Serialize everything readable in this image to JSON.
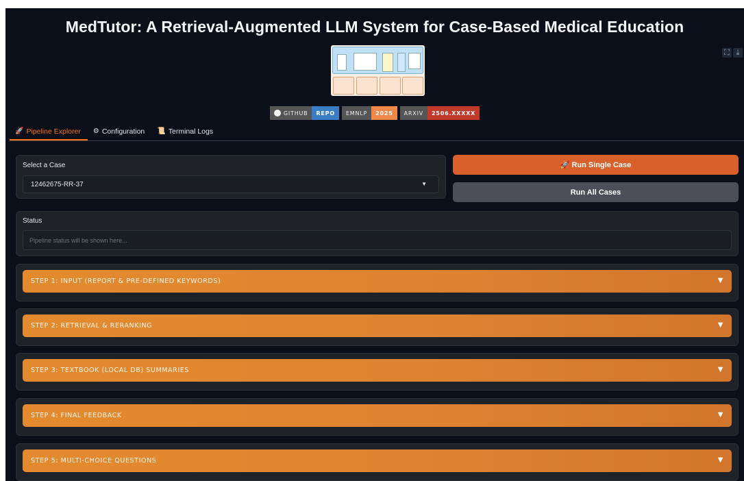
{
  "header": {
    "title": "MedTutor: A Retrieval-Augmented LLM System for Case-Based Medical Education"
  },
  "badges": [
    {
      "left": "GITHUB",
      "right": "REPO",
      "color": "#3b7dc4",
      "icon": "github-icon"
    },
    {
      "left": "EMNLP",
      "right": "2025",
      "color": "#f0884a"
    },
    {
      "left": "ARXIV",
      "right": "2506.XXXXX",
      "color": "#c0392b"
    }
  ],
  "tabs": [
    {
      "label": "Pipeline Explorer",
      "icon": "🚀",
      "active": true
    },
    {
      "label": "Configuration",
      "icon": "⚙",
      "active": false
    },
    {
      "label": "Terminal Logs",
      "icon": "📜",
      "active": false
    }
  ],
  "case_select": {
    "label": "Select a Case",
    "value": "12462675-RR-37"
  },
  "buttons": {
    "run_single": "🚀 Run Single Case",
    "run_all": "Run All Cases"
  },
  "status": {
    "label": "Status",
    "placeholder": "Pipeline status will be shown here..."
  },
  "steps": [
    "STEP 1: INPUT (REPORT & PRE-DEFINED KEYWORDS)",
    "STEP 2: RETRIEVAL & RERANKING",
    "STEP 3: TEXTBOOK (LOCAL DB) SUMMARIES",
    "STEP 4: FINAL FEEDBACK",
    "STEP 5: MULTI-CHOICE QUESTIONS"
  ],
  "colors": {
    "accent": "#f97316",
    "run_button": "#d9602a",
    "step_bar": "#e48a2e",
    "background": "#0b0f19"
  }
}
